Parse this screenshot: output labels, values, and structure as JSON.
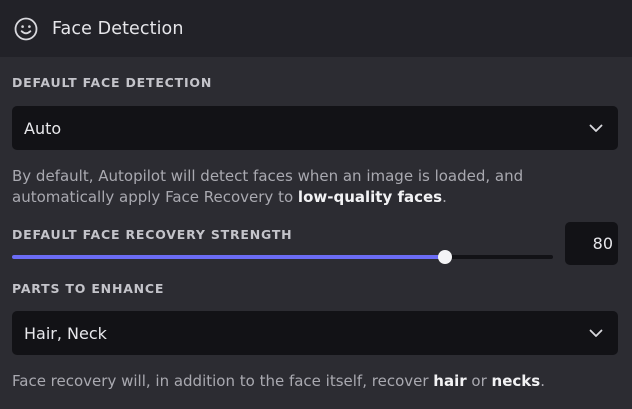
{
  "header": {
    "icon": "smiley-face-icon",
    "title": "Face Detection"
  },
  "default_detection": {
    "label": "DEFAULT FACE DETECTION",
    "selected": "Auto",
    "help_prefix": "By default, Autopilot will detect faces when an image is loaded, and automatically apply Face Recovery to ",
    "help_bold": "low-quality faces",
    "help_suffix": "."
  },
  "recovery_strength": {
    "label": "DEFAULT FACE RECOVERY STRENGTH",
    "value": "80",
    "value_fraction": 0.8,
    "accent_color": "#6b6cf5"
  },
  "parts_to_enhance": {
    "label": "PARTS TO ENHANCE",
    "selected": "Hair, Neck",
    "help_prefix": "Face recovery will, in addition to the face itself, recover ",
    "help_bold_1": "hair",
    "help_middle": " or ",
    "help_bold_2": "necks",
    "help_suffix": "."
  }
}
